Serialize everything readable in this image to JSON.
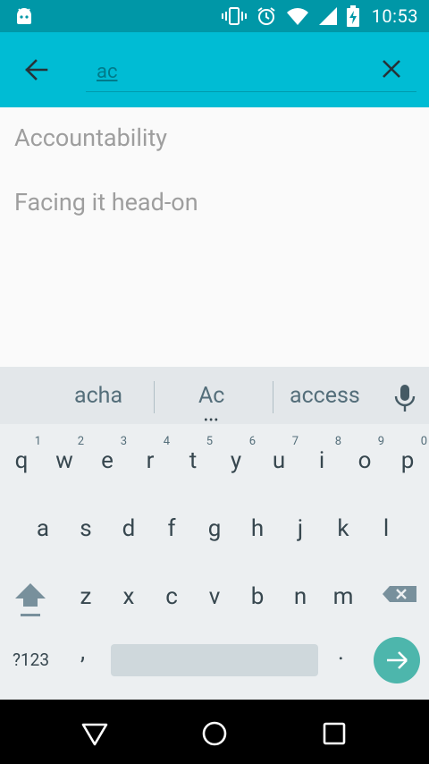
{
  "status_bar": {
    "time": "10:53",
    "icons": [
      "android-icon",
      "vibrate-icon",
      "alarm-icon",
      "wifi-icon",
      "signal-icon",
      "battery-charging-icon"
    ]
  },
  "search": {
    "query": "ac"
  },
  "results": [
    {
      "label": "Accountability"
    },
    {
      "label": "Facing it head-on"
    }
  ],
  "keyboard": {
    "suggestions": [
      "acha",
      "Ac",
      "access"
    ],
    "row1": [
      {
        "ch": "q",
        "hint": "1"
      },
      {
        "ch": "w",
        "hint": "2"
      },
      {
        "ch": "e",
        "hint": "3"
      },
      {
        "ch": "r",
        "hint": "4"
      },
      {
        "ch": "t",
        "hint": "5"
      },
      {
        "ch": "y",
        "hint": "6"
      },
      {
        "ch": "u",
        "hint": "7"
      },
      {
        "ch": "i",
        "hint": "8"
      },
      {
        "ch": "o",
        "hint": "9"
      },
      {
        "ch": "p",
        "hint": "0"
      }
    ],
    "row2": [
      "a",
      "s",
      "d",
      "f",
      "g",
      "h",
      "j",
      "k",
      "l"
    ],
    "row3": [
      "z",
      "x",
      "c",
      "v",
      "b",
      "n",
      "m"
    ],
    "symbols_label": "?123",
    "comma": ",",
    "period": "."
  },
  "colors": {
    "toolbar": "#00bcd4",
    "statusbar": "#0097a7",
    "enter_key": "#4db6ac"
  }
}
